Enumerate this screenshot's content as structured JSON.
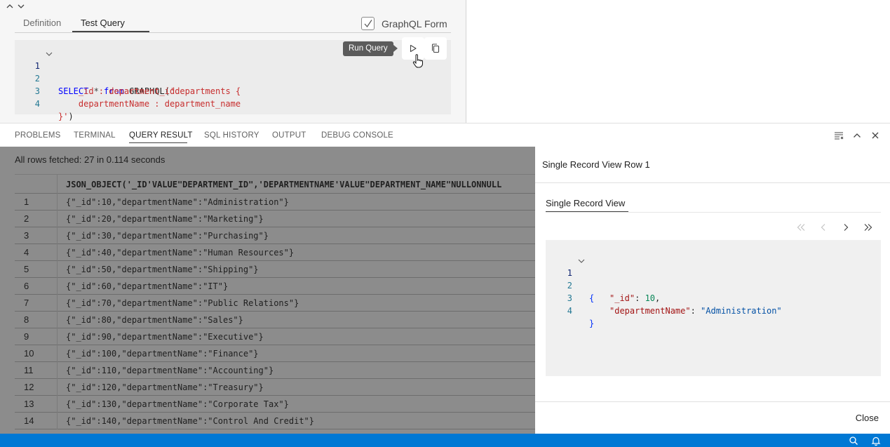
{
  "editor": {
    "tabs": [
      "Definition",
      "Test Query"
    ],
    "graphql_form_label": "GraphQL Form",
    "graphql_form_checked": true,
    "run_tooltip": "Run Query",
    "line_numbers": [
      "1",
      "2",
      "3",
      "4"
    ],
    "code": {
      "l1_kw1": "SELECT",
      "l1_op": " * ",
      "l1_kw2": "from",
      "l1_fn": " GRAPHQL(",
      "l1_str": "'departments {",
      "l2_str": "    _id : department_id",
      "l3_str": "    departmentName : department_name",
      "l4_str": "}'",
      "l4_close": ")"
    }
  },
  "panel": {
    "tabs": [
      "PROBLEMS",
      "TERMINAL",
      "QUERY RESULT",
      "SQL HISTORY",
      "OUTPUT",
      "DEBUG CONSOLE"
    ],
    "active_tab": "QUERY RESULT"
  },
  "result": {
    "fetched_text": "All rows fetched: 27 in 0.114 seconds",
    "column_header": "JSON_OBJECT('_ID'VALUE\"DEPARTMENT_ID\",'DEPARTMENTNAME'VALUE\"DEPARTMENT_NAME\"NULLONNULL",
    "rows": [
      {
        "n": "1",
        "v": "{\"_id\":10,\"departmentName\":\"Administration\"}"
      },
      {
        "n": "2",
        "v": "{\"_id\":20,\"departmentName\":\"Marketing\"}"
      },
      {
        "n": "3",
        "v": "{\"_id\":30,\"departmentName\":\"Purchasing\"}"
      },
      {
        "n": "4",
        "v": "{\"_id\":40,\"departmentName\":\"Human Resources\"}"
      },
      {
        "n": "5",
        "v": "{\"_id\":50,\"departmentName\":\"Shipping\"}"
      },
      {
        "n": "6",
        "v": "{\"_id\":60,\"departmentName\":\"IT\"}"
      },
      {
        "n": "7",
        "v": "{\"_id\":70,\"departmentName\":\"Public Relations\"}"
      },
      {
        "n": "8",
        "v": "{\"_id\":80,\"departmentName\":\"Sales\"}"
      },
      {
        "n": "9",
        "v": "{\"_id\":90,\"departmentName\":\"Executive\"}"
      },
      {
        "n": "10",
        "v": "{\"_id\":100,\"departmentName\":\"Finance\"}"
      },
      {
        "n": "11",
        "v": "{\"_id\":110,\"departmentName\":\"Accounting\"}"
      },
      {
        "n": "12",
        "v": "{\"_id\":120,\"departmentName\":\"Treasury\"}"
      },
      {
        "n": "13",
        "v": "{\"_id\":130,\"departmentName\":\"Corporate Tax\"}"
      },
      {
        "n": "14",
        "v": "{\"_id\":140,\"departmentName\":\"Control And Credit\"}"
      }
    ]
  },
  "single_record": {
    "title": "Single Record View Row 1",
    "tab_label": "Single Record View",
    "line_numbers": [
      "1",
      "2",
      "3",
      "4"
    ],
    "json": {
      "open": "{",
      "key1": "\"_id\"",
      "val1": "10",
      "key2": "\"departmentName\"",
      "val2": "\"Administration\"",
      "close": "}"
    },
    "close_label": "Close"
  },
  "colors": {
    "statusbar": "#0078d4",
    "sql_keyword": "#0000ff",
    "sql_string": "#c72e2e",
    "json_key": "#a31515",
    "json_number": "#098658",
    "json_string": "#0451a5"
  }
}
